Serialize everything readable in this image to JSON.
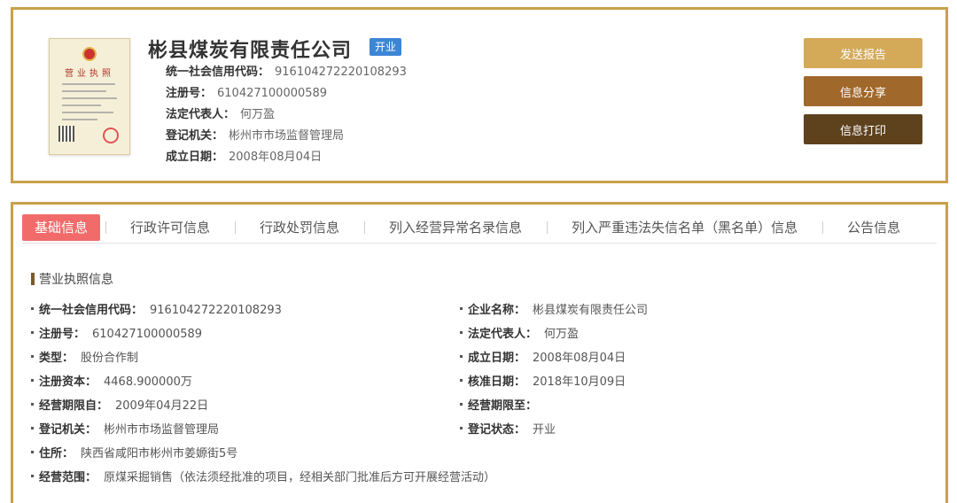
{
  "company": {
    "name": "彬县煤炭有限责任公司",
    "status": "开业",
    "license_image_title": "营业执照"
  },
  "summary": [
    {
      "label": "统一社会信用代码：",
      "value": "916104272220108293"
    },
    {
      "label": "注册号：",
      "value": "610427100000589"
    },
    {
      "label": "法定代表人：",
      "value": "何万盈"
    },
    {
      "label": "登记机关：",
      "value": "彬州市市场监督管理局"
    },
    {
      "label": "成立日期：",
      "value": "2008年08月04日"
    }
  ],
  "actions": {
    "report": "发送报告",
    "share": "信息分享",
    "print": "信息打印"
  },
  "tabs": [
    "基础信息",
    "行政许可信息",
    "行政处罚信息",
    "列入经营异常名录信息",
    "列入严重违法失信名单（黑名单）信息",
    "公告信息"
  ],
  "section": {
    "title": "营业执照信息"
  },
  "fields": {
    "credit_code": {
      "label": "统一社会信用代码：",
      "value": "916104272220108293"
    },
    "company_name": {
      "label": "企业名称：",
      "value": "彬县煤炭有限责任公司"
    },
    "reg_no": {
      "label": "注册号：",
      "value": "610427100000589"
    },
    "legal_rep": {
      "label": "法定代表人：",
      "value": "何万盈"
    },
    "type": {
      "label": "类型：",
      "value": "股份合作制"
    },
    "founded": {
      "label": "成立日期：",
      "value": "2008年08月04日"
    },
    "capital": {
      "label": "注册资本：",
      "value": "4468.900000万"
    },
    "approved": {
      "label": "核准日期：",
      "value": "2018年10月09日"
    },
    "period_from": {
      "label": "经营期限自：",
      "value": "2009年04月22日"
    },
    "period_to": {
      "label": "经营期限至：",
      "value": ""
    },
    "authority": {
      "label": "登记机关：",
      "value": "彬州市市场监督管理局"
    },
    "reg_status": {
      "label": "登记状态：",
      "value": "开业"
    },
    "address": {
      "label": "住所：",
      "value": "陕西省咸阳市彬州市姜嫄街5号"
    },
    "scope": {
      "label": "经营范围：",
      "value": "原煤采掘销售（依法须经批准的项目，经相关部门批准后方可开展经营活动）"
    }
  }
}
